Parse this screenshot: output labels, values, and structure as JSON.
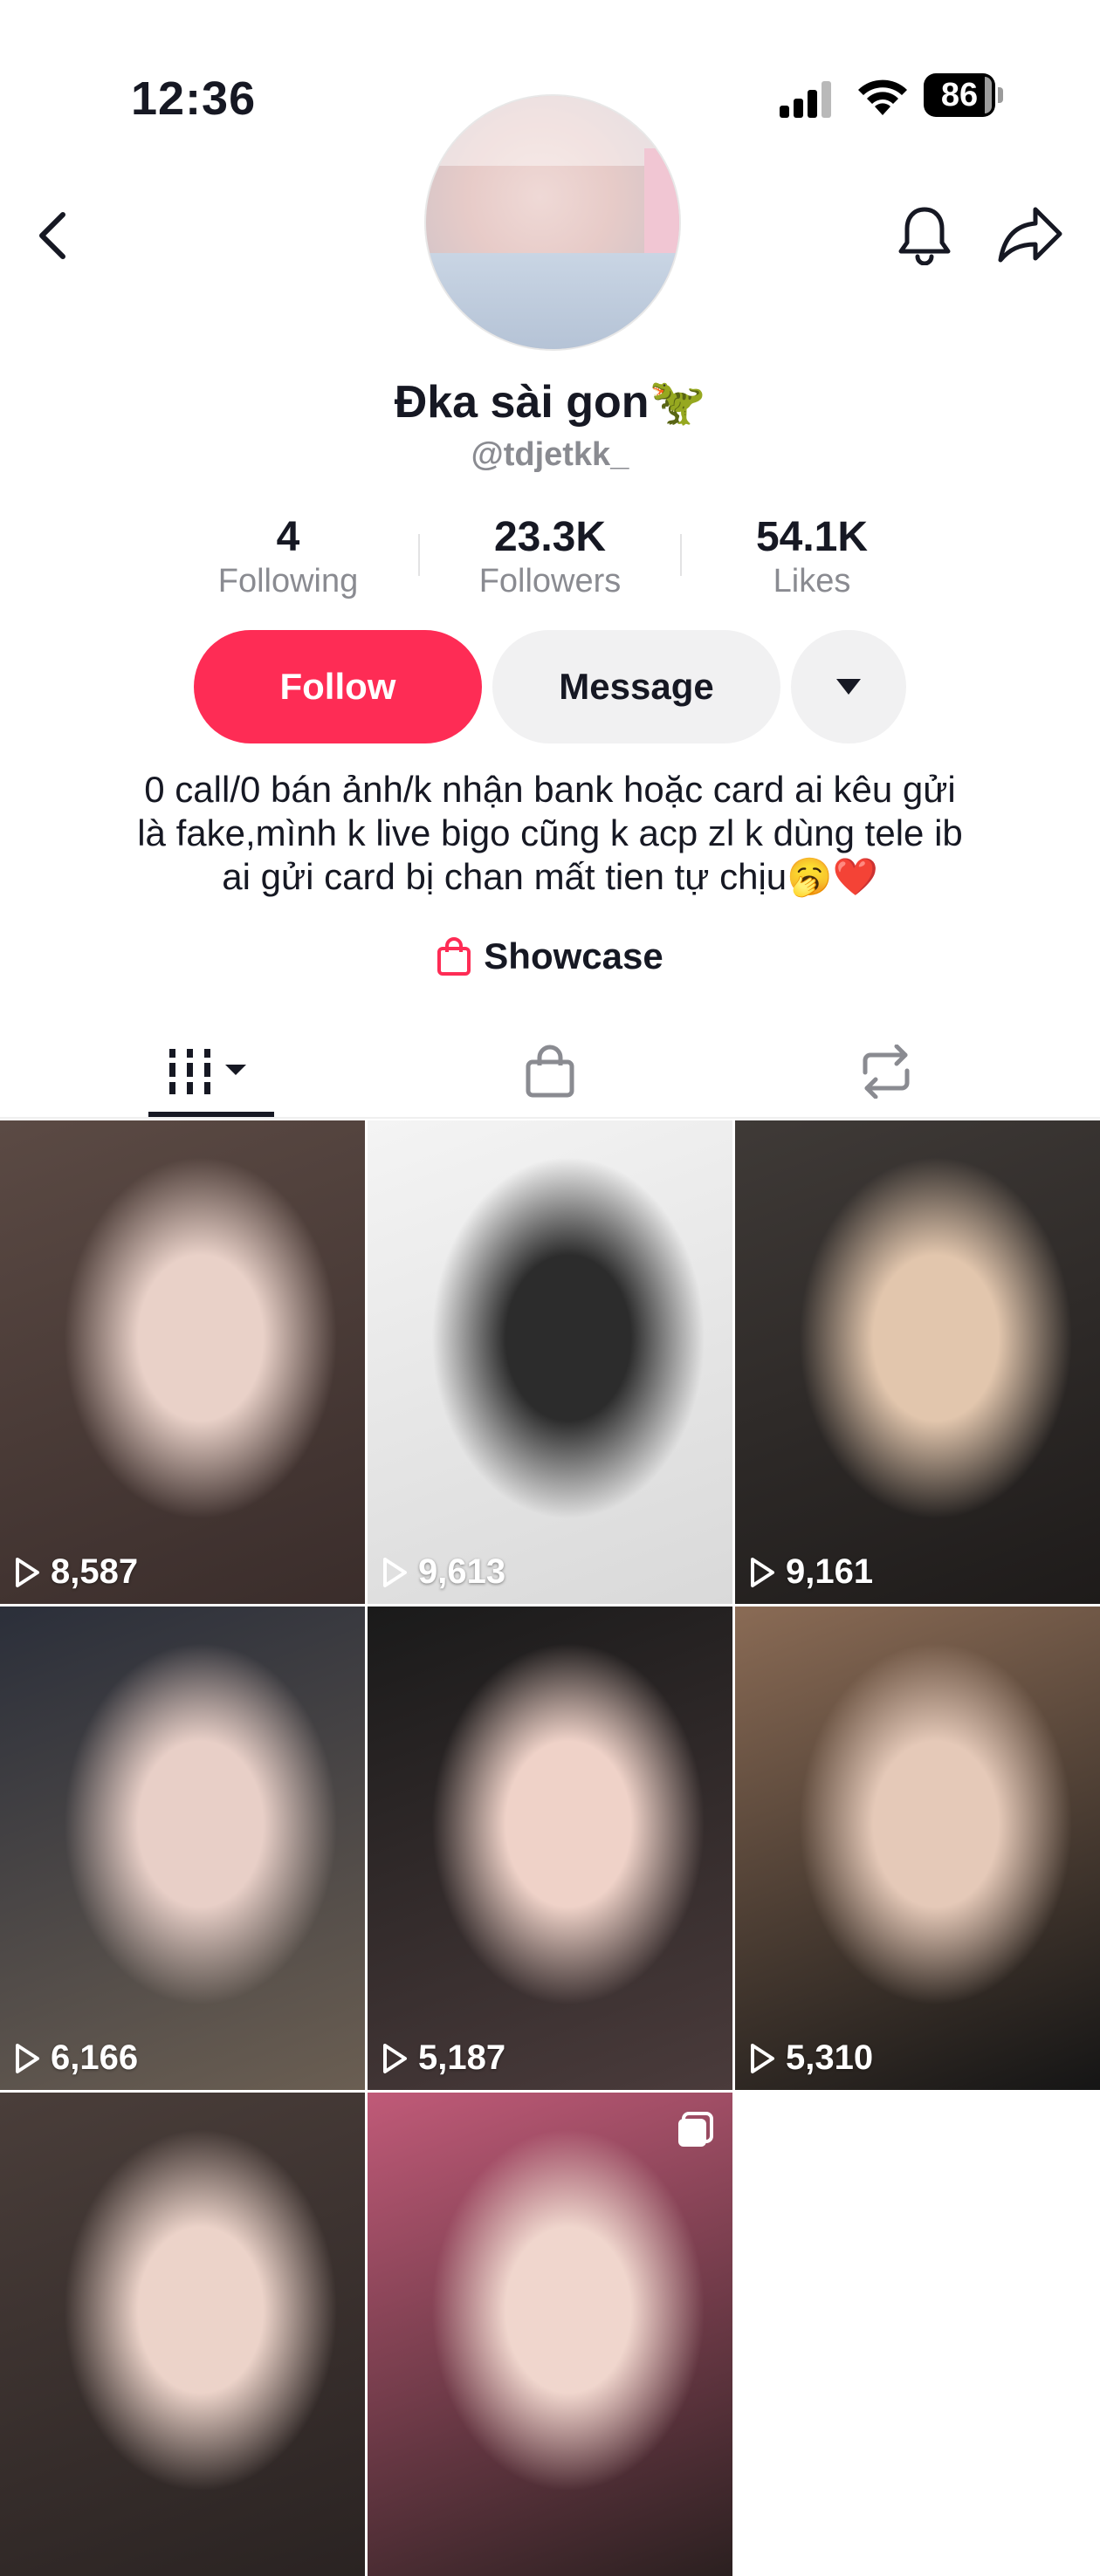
{
  "status_bar": {
    "time": "12:36",
    "battery": "86"
  },
  "profile": {
    "display_name": "Đka sài gon🦖",
    "handle": "@tdjetkk_",
    "stats": [
      {
        "value": "4",
        "label": "Following"
      },
      {
        "value": "23.3K",
        "label": "Followers"
      },
      {
        "value": "54.1K",
        "label": "Likes"
      }
    ],
    "buttons": {
      "follow": "Follow",
      "message": "Message"
    },
    "bio_lines": [
      "0 call/0 bán ảnh/k nhận bank hoặc card ai kêu gửi",
      "là fake,mình k live bigo cũng k acp zl k dùng tele ib",
      "ai gửi card bị chan mất tien tự chịu🥱❤️"
    ],
    "showcase": "Showcase"
  },
  "videos": [
    {
      "views": "8,587",
      "colors": [
        "#5b4a44",
        "#e9d1c8",
        "#3a2d2b"
      ]
    },
    {
      "views": "9,613",
      "colors": [
        "#f4f4f4",
        "#2c2c2c",
        "#d9d9d9"
      ]
    },
    {
      "views": "9,161",
      "colors": [
        "#3f3a37",
        "#e2c6ad",
        "#1e1b1a"
      ]
    },
    {
      "views": "6,166",
      "colors": [
        "#2b2f3a",
        "#e8cfc7",
        "#6a5e52"
      ]
    },
    {
      "views": "5,187",
      "colors": [
        "#1a1a1a",
        "#efd2c8",
        "#4a3b3b"
      ]
    },
    {
      "views": "5,310",
      "colors": [
        "#8a6b55",
        "#e5c9b8",
        "#151515"
      ]
    },
    {
      "views": "",
      "colors": [
        "#4a3e3a",
        "#ecd3c9",
        "#2a2322"
      ]
    },
    {
      "views": "",
      "colors": [
        "#c05a78",
        "#f0d6cd",
        "#2b2020"
      ]
    }
  ],
  "colors": {
    "accent": "#fe2c55",
    "text": "#161823",
    "muted": "#8a8b91"
  },
  "icons": [
    "back-icon",
    "bell-icon",
    "share-icon",
    "chevron-down-icon",
    "shopping-bag-icon",
    "grid-icon",
    "repost-icon",
    "play-icon",
    "multi-photo-icon"
  ]
}
